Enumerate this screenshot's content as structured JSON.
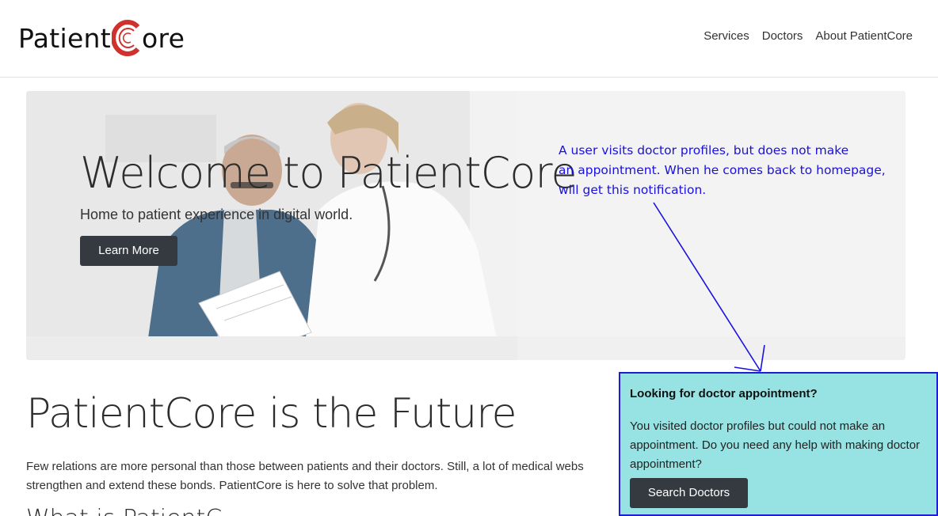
{
  "header": {
    "logo_prefix": "Patient",
    "logo_suffix": "ore",
    "nav": [
      "Services",
      "Doctors",
      "About PatientCore"
    ]
  },
  "hero": {
    "title": "Welcome to PatientCore",
    "subtitle": "Home to patient experience in digital world.",
    "button": "Learn More"
  },
  "content": {
    "heading": "PatientCore is the Future",
    "paragraph_line1": "Few relations are more personal than those between patients and their doctors. Still, a lot of medical webs",
    "paragraph_line2": "strengthen and extend these bonds. PatientCore is here to solve that problem.",
    "subheading": "What is PatientC"
  },
  "notification": {
    "title": "Looking for doctor appointment?",
    "body": "You visited doctor profiles but could not make an appointment. Do you need any help with making doctor appointment?",
    "button": "Search Doctors"
  },
  "annotation": {
    "line1": "A user visits doctor profiles, but does not make",
    "line2": "an appointment. When he comes back to homepage,",
    "line3": "will get this notification."
  },
  "colors": {
    "brand_red": "#d0312d",
    "dark_button": "#343a40",
    "notification_bg": "#97e3e3",
    "annotation_blue": "#1a10e0"
  }
}
